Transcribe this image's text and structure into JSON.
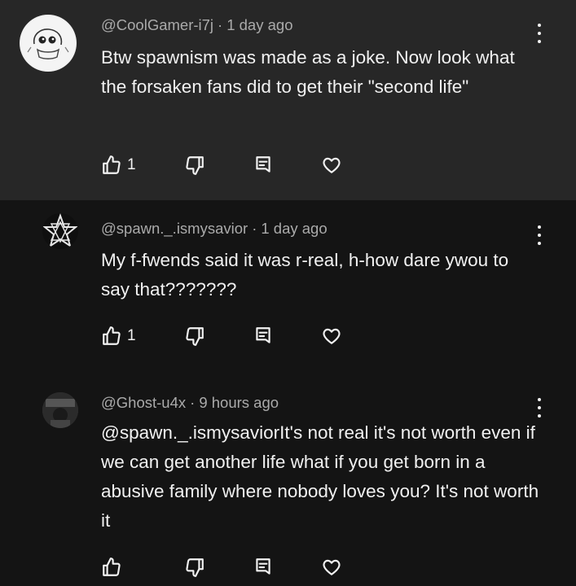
{
  "comments": [
    {
      "handle": "@CoolGamer-i7j",
      "time": "1 day ago",
      "text": "Btw spawnism was made as a joke. Now look what the forsaken fans did to get their \"second life\"",
      "likes": "1",
      "avatar_icon": "doodle-face-icon"
    },
    {
      "handle": "@spawn._.ismysavior",
      "time": "1 day ago",
      "text": "My f-fwends said it was r-real, h-how dare ywou to say that???????",
      "likes": "1",
      "avatar_icon": "pentagram-icon"
    },
    {
      "handle": "@Ghost-u4x",
      "time": "9 hours ago",
      "text": "@spawn._.ismysaviorIt's not real it's not worth even if we can get another life what if you get born in a abusive family where nobody loves you? It's not worth it",
      "likes": "",
      "avatar_icon": "dark-photo-icon"
    }
  ],
  "separator": "·",
  "colors": {
    "background": "#0f0f0f",
    "highlighted_comment": "#272727",
    "text": "#f1f1f1",
    "meta_text": "#aaaaaa"
  }
}
